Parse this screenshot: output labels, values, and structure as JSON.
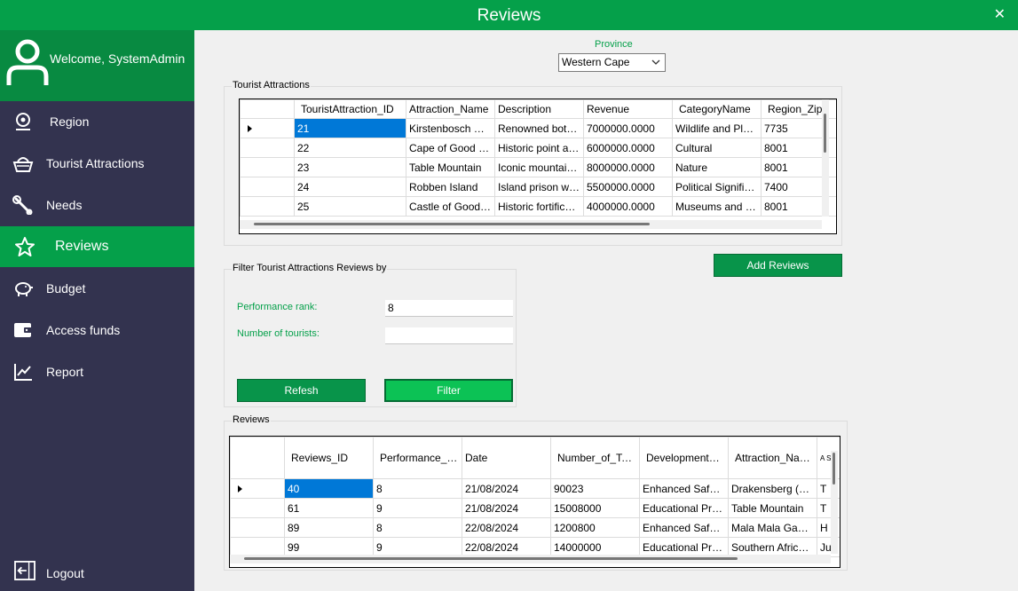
{
  "window": {
    "title": "Reviews",
    "close_glyph": "✕"
  },
  "sidebar": {
    "welcome": "Welcome, SystemAdmin",
    "items": [
      {
        "label": "Region",
        "icon": "location-pin-icon"
      },
      {
        "label": "Tourist Attractions",
        "icon": "basket-icon"
      },
      {
        "label": "Needs",
        "icon": "wrench-icon"
      },
      {
        "label": "Reviews",
        "icon": "star-icon"
      },
      {
        "label": "Budget",
        "icon": "piggy-bank-icon"
      },
      {
        "label": "Access funds",
        "icon": "wallet-icon"
      },
      {
        "label": "Report",
        "icon": "line-chart-icon"
      }
    ],
    "logout": "Logout"
  },
  "province": {
    "label": "Province",
    "value": "Western Cape"
  },
  "attractions": {
    "title": "Tourist Attractions",
    "columns": [
      "TouristAttraction_ID",
      "Attraction_Name",
      "Description",
      "Revenue",
      "CategoryName",
      "Region_Zip_"
    ],
    "rows": [
      [
        "21",
        "Kirstenbosch Nati...",
        "Renowned botan...",
        "7000000.0000",
        "Wildlife and Plant...",
        "7735"
      ],
      [
        "22",
        "Cape of Good Ho...",
        "Historic point at t...",
        "6000000.0000",
        "Cultural",
        "8001"
      ],
      [
        "23",
        "Table Mountain",
        "Iconic mountain ...",
        "8000000.0000",
        "Nature",
        "8001"
      ],
      [
        "24",
        "Robben Island",
        "Island prison whe...",
        "5500000.0000",
        "Political Significa...",
        "7400"
      ],
      [
        "25",
        "Castle of Good H...",
        "Historic fortificatio...",
        "4000000.0000",
        "Museums and ar...",
        "8001"
      ]
    ]
  },
  "add_reviews": "Add Reviews",
  "filter": {
    "title": "Filter Tourist Attractions Reviews by",
    "rank_label": "Performance rank:",
    "rank_value": "8",
    "tourists_label": "Number of tourists:",
    "tourists_value": "",
    "refresh": "Refesh",
    "filter": "Filter"
  },
  "reviews": {
    "title": "Reviews",
    "columns": [
      "Reviews_ID",
      "Performance_Rank",
      "Date",
      "Number_of_Tourist",
      "Development_Nam",
      "Attraction_Name",
      "A S F"
    ],
    "rows": [
      [
        "40",
        "8",
        "21/08/2024",
        "90023",
        "Enhanced Safety...",
        "Drakensberg (Mo...",
        "T"
      ],
      [
        "61",
        "9",
        "21/08/2024",
        "15008000",
        "Educational Prog...",
        "Table Mountain",
        "T"
      ],
      [
        "89",
        "8",
        "22/08/2024",
        "1200800",
        "Enhanced Safety...",
        "Mala Mala Game ...",
        "H"
      ],
      [
        "99",
        "9",
        "22/08/2024",
        "14000000",
        "Educational Prog...",
        "Southern African ...",
        "Ju"
      ]
    ]
  }
}
